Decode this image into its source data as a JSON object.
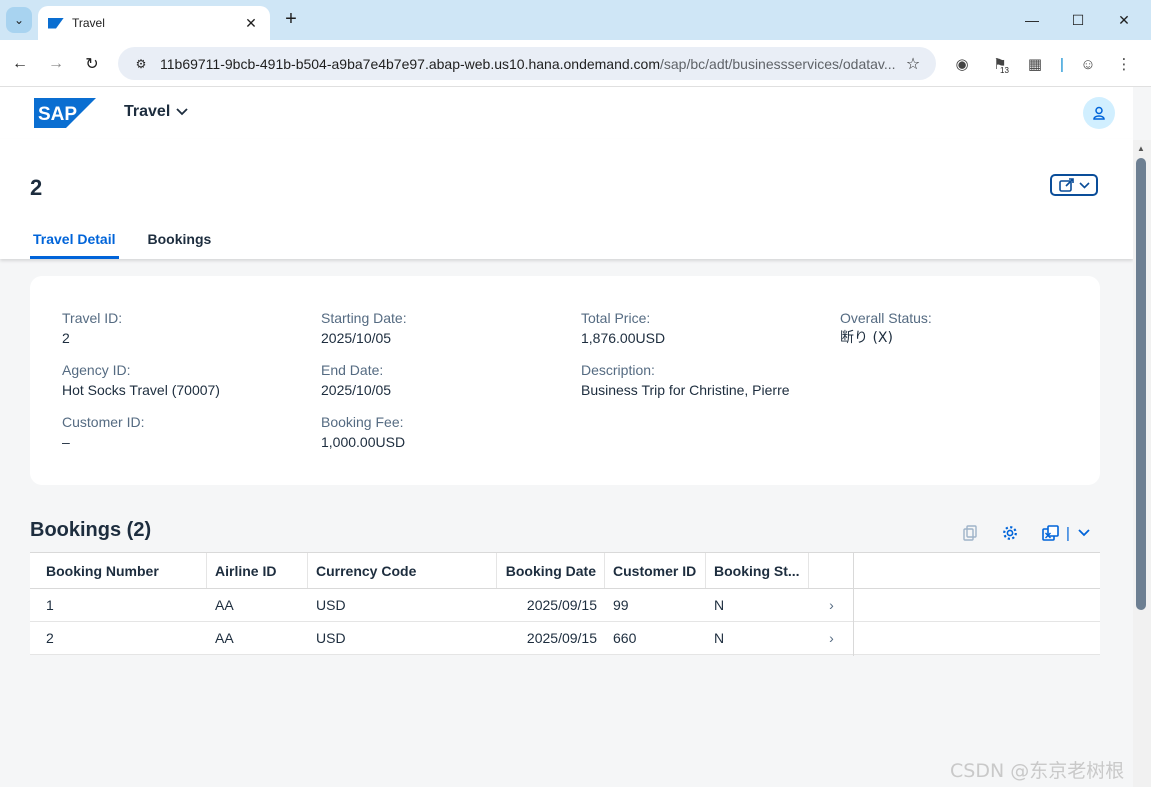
{
  "browser": {
    "tab_title": "Travel",
    "url_host": "11b69711-9bcb-491b-b504-a9ba7e4b7e97.abap-web.us10.hana.ondemand.com",
    "url_path": "/sap/bc/adt/businessservices/odatav...",
    "extension_badge": "13"
  },
  "shell": {
    "logo_text": "SAP",
    "app_title": "Travel"
  },
  "header": {
    "title": "2",
    "tabs": [
      {
        "label": "Travel Detail",
        "active": true
      },
      {
        "label": "Bookings",
        "active": false
      }
    ]
  },
  "details": {
    "travel_id": {
      "label": "Travel ID:",
      "value": "2"
    },
    "agency_id": {
      "label": "Agency ID:",
      "value": "Hot Socks Travel (70007)"
    },
    "customer_id": {
      "label": "Customer ID:",
      "value": "–"
    },
    "starting_date": {
      "label": "Starting Date:",
      "value": "2025/10/05"
    },
    "end_date": {
      "label": "End Date:",
      "value": "2025/10/05"
    },
    "booking_fee": {
      "label": "Booking Fee:",
      "value": "1,000.00USD"
    },
    "total_price": {
      "label": "Total Price:",
      "value": "1,876.00USD"
    },
    "description": {
      "label": "Description:",
      "value": "Business Trip for Christine, Pierre"
    },
    "overall_status": {
      "label": "Overall Status:",
      "value": "断り (X)"
    }
  },
  "bookings": {
    "title": "Bookings (2)",
    "columns": [
      "Booking Number",
      "Airline ID",
      "Currency Code",
      "Booking Date",
      "Customer ID",
      "Booking St..."
    ],
    "rows": [
      [
        "1",
        "AA",
        "USD",
        "2025/09/15",
        "99",
        "N"
      ],
      [
        "2",
        "AA",
        "USD",
        "2025/09/15",
        "660",
        "N"
      ]
    ]
  },
  "watermark": "CSDN @东京老树根",
  "colors": {
    "accent": "#0064d9",
    "shell_bg": "#ffffff",
    "page_bg": "#f5f6f7",
    "text": "#1d2d3e",
    "label": "#556b82"
  }
}
